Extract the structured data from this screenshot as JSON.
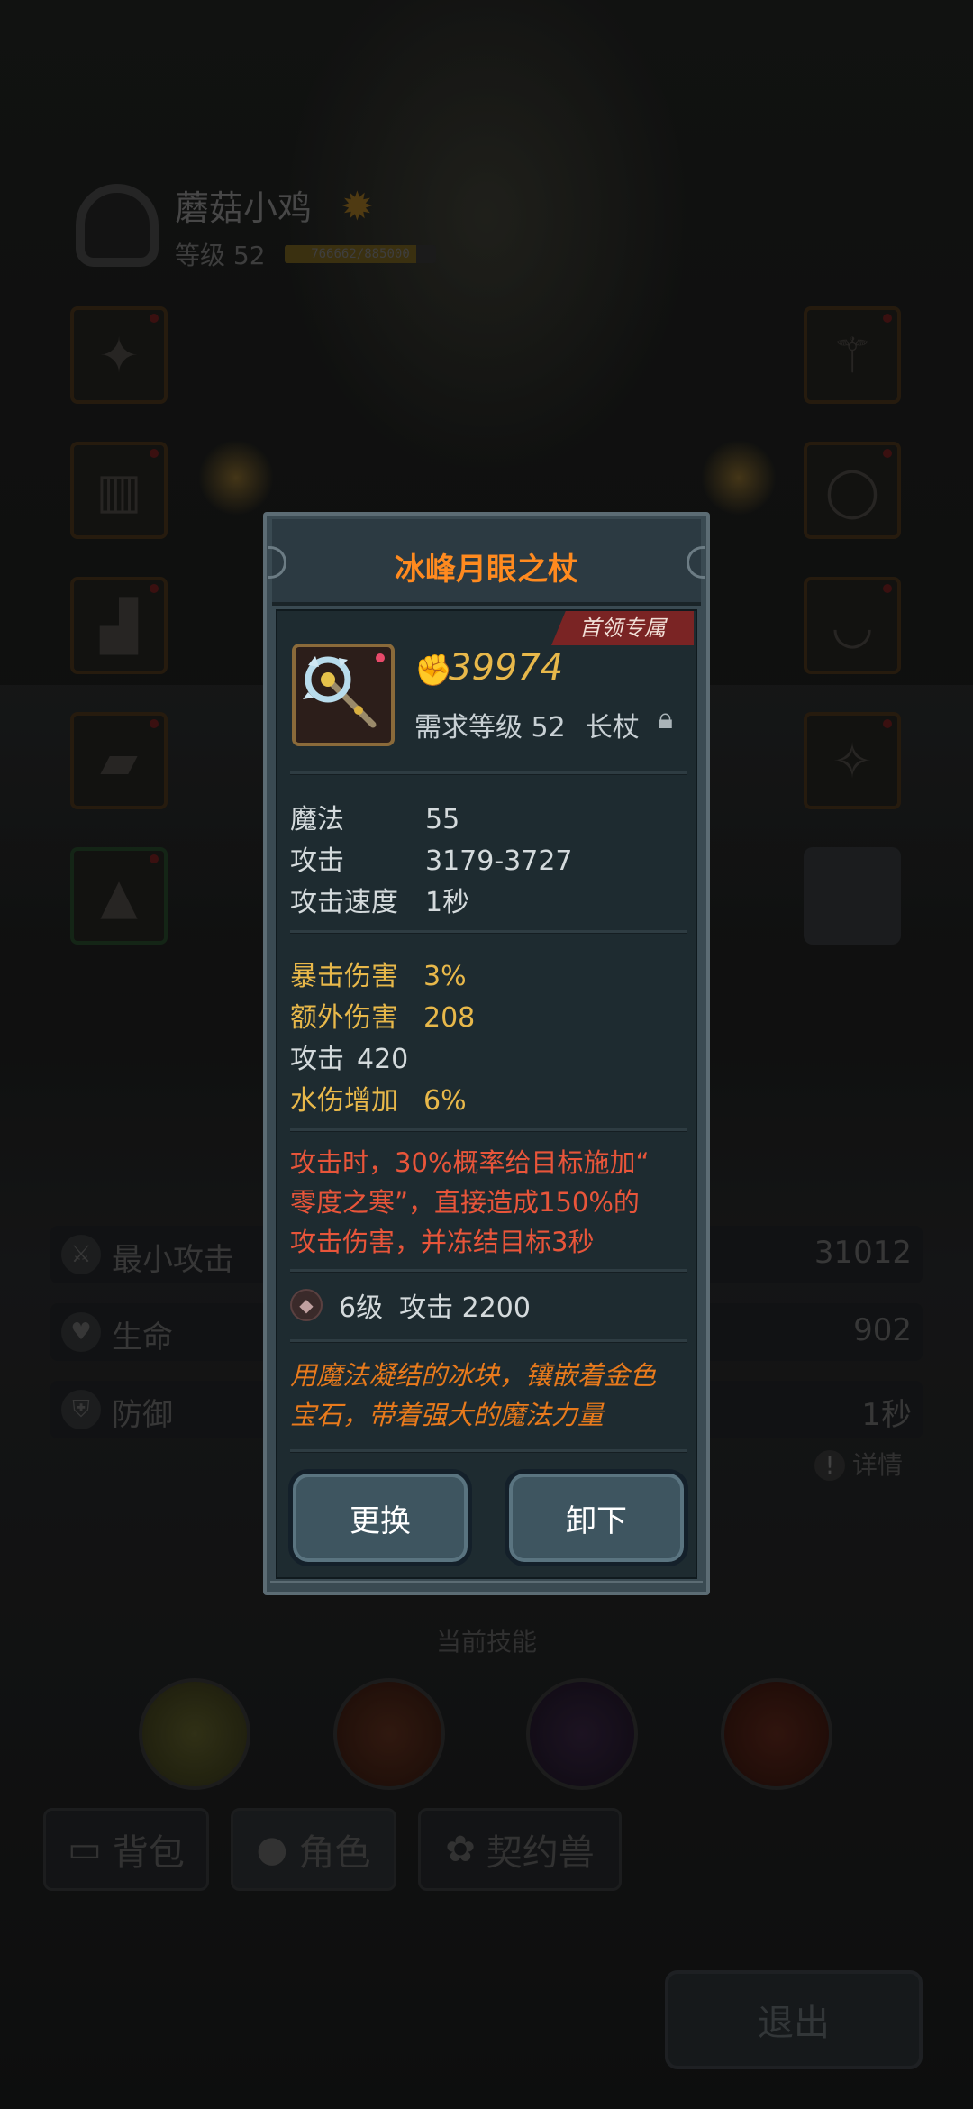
{
  "player": {
    "name": "蘑菇小鸡",
    "level": "等级 52",
    "xp_text": "766662/885000",
    "xp_progress": 0.87
  },
  "slots_left": [
    "chest-armor-icon",
    "robe-icon",
    "boots-icon",
    "bracer-icon",
    "cloak-icon"
  ],
  "slots_right": [
    "staff-icon",
    "ring-icon",
    "necklace-icon",
    "amulet-icon"
  ],
  "stats": [
    {
      "label": "最小攻击",
      "value": "31012",
      "icon": "sword-icon"
    },
    {
      "label": "生命",
      "value": "902",
      "icon": "heart-icon"
    },
    {
      "label": "防御",
      "value": "1秒",
      "icon": "shield-icon"
    }
  ],
  "details_label": "详情",
  "current_skills_label": "当前技能",
  "tabs": [
    {
      "label": "背包",
      "icon": "bag-icon"
    },
    {
      "label": "角色",
      "icon": "character-icon"
    },
    {
      "label": "契约兽",
      "icon": "paw-icon"
    }
  ],
  "exit_label": "退出",
  "item": {
    "name": "冰峰月眼之杖",
    "badge": "首领专属",
    "power": "39974",
    "required_level": "需求等级 52",
    "type": "长杖",
    "base_attrs": [
      {
        "k": "魔法",
        "v": "55"
      },
      {
        "k": "攻击",
        "v": "3179-3727"
      },
      {
        "k": "攻击速度",
        "v": "1秒"
      }
    ],
    "bonus_attrs": [
      {
        "k": "暴击伤害",
        "v": "3%",
        "color": "#e8b84a"
      },
      {
        "k": "额外伤害",
        "v": "208",
        "color": "#e8b84a"
      },
      {
        "k": "攻击",
        "v": "420",
        "color": "#d4dadc"
      },
      {
        "k": "水伤增加",
        "v": "6%",
        "color": "#e8b84a"
      }
    ],
    "skill_lines": [
      "攻击时，30%概率给目标施加“",
      "零度之寒”，直接造成150%的",
      "攻击伤害，并冻结目标3秒"
    ],
    "gem_level": "6级",
    "gem_bonus": "攻击 2200",
    "flavor_lines": [
      "用魔法凝结的冰块，镶嵌着金色",
      "宝石，带着强大的魔法力量"
    ],
    "replace_label": "更换",
    "unequip_label": "卸下"
  },
  "colors": {
    "title": "#ff8a1f",
    "power": "#e8b84a",
    "skill_text": "#e8553a",
    "flavor": "#e87a1c",
    "badge": "#7a2424"
  }
}
